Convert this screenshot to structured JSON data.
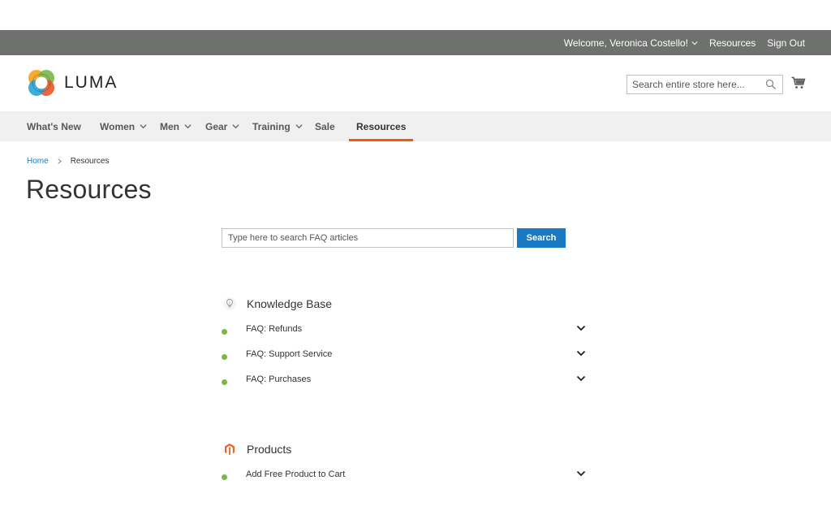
{
  "panel": {
    "welcome": "Welcome, Veronica Costello!",
    "resources_link": "Resources",
    "signout_link": "Sign Out"
  },
  "header": {
    "logo_text": "LUMA",
    "search_placeholder": "Search entire store here...",
    "icons": {
      "search": "search-icon",
      "cart": "cart-icon"
    }
  },
  "nav": {
    "items": [
      {
        "label": "What's New",
        "dropdown": false
      },
      {
        "label": "Women",
        "dropdown": true
      },
      {
        "label": "Men",
        "dropdown": true
      },
      {
        "label": "Gear",
        "dropdown": true
      },
      {
        "label": "Training",
        "dropdown": true
      },
      {
        "label": "Sale",
        "dropdown": false
      },
      {
        "label": "Resources",
        "dropdown": false,
        "active": true
      }
    ],
    "active_color": "#ff5501"
  },
  "breadcrumbs": {
    "home": "Home",
    "current": "Resources"
  },
  "page": {
    "title": "Resources"
  },
  "faq_search": {
    "placeholder": "Type here to search FAQ articles",
    "button": "Search",
    "button_color": "#1979c3"
  },
  "sections": [
    {
      "title": "Knowledge Base",
      "icon": "lightbulb-icon",
      "items": [
        "FAQ: Refunds",
        "FAQ: Support Service",
        "FAQ: Purchases"
      ]
    },
    {
      "title": "Products",
      "icon": "magento-icon",
      "items": [
        "Add Free Product to Cart"
      ]
    }
  ],
  "colors": {
    "bullet": "#7ab648",
    "header_bar": "#6e716e",
    "nav_bg": "#f0f0f0",
    "link": "#1979c3"
  }
}
